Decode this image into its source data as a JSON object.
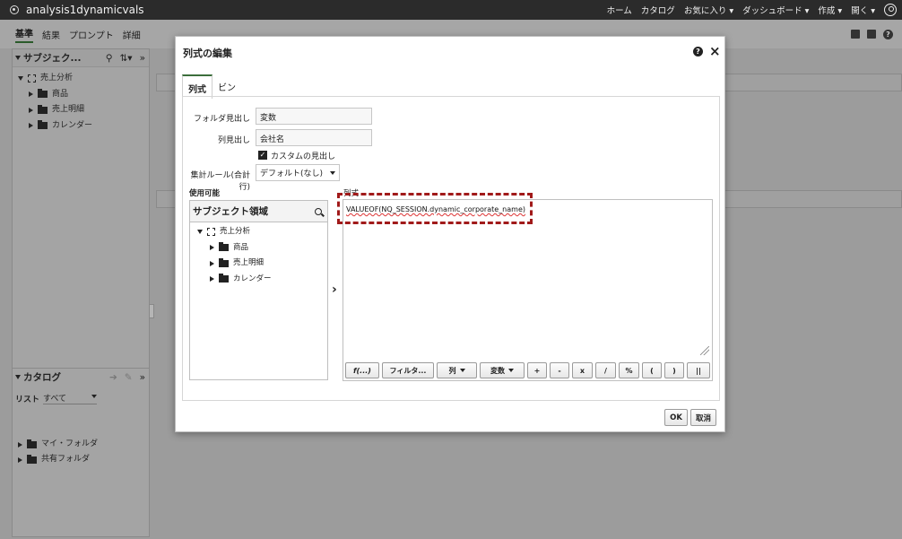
{
  "header": {
    "app_title": "analysis1dynamicvals",
    "nav_items": [
      "ホーム",
      "カタログ",
      "お気に入り ▾",
      "ダッシュボード ▾",
      "作成 ▾",
      "開く ▾"
    ]
  },
  "editor_tabs": [
    "基準",
    "結果",
    "プロンプト",
    "詳細"
  ],
  "left_panel": {
    "title": "サブジェク...",
    "tree": {
      "root": "売上分析",
      "children": [
        "商品",
        "売上明細",
        "カレンダー"
      ]
    },
    "catalog_title": "カタログ",
    "catalog_list_label": "リスト",
    "catalog_list_value": "すべて",
    "catalog_tree": [
      "マイ・フォルダ",
      "共有フォルダ"
    ]
  },
  "dialog": {
    "title": "列式の編集",
    "tabs": [
      "列式",
      "ビン"
    ],
    "folder_heading_label": "フォルダ見出し",
    "folder_heading_value": "変数",
    "column_heading_label": "列見出し",
    "column_heading_value": "会社名",
    "custom_heading_checkbox": "カスタムの見出し",
    "aggregation_label": "集計ルール(合計行)",
    "aggregation_value": "デフォルト(なし)",
    "available_label": "使用可能",
    "subject_area_title": "サブジェクト領域",
    "subject_tree": {
      "root": "売上分析",
      "children": [
        "商品",
        "売上明細",
        "カレンダー"
      ]
    },
    "expression_label": "列式",
    "expression_text": "VALUEOF(NQ_SESSION.dynamic_corporate_name)",
    "buttons": {
      "func": "f(...)",
      "filter": "フィルタ...",
      "column": "列",
      "variable": "変数",
      "plus": "+",
      "minus": "-",
      "times": "x",
      "divide": "/",
      "percent": "%",
      "lparen": "(",
      "rparen": ")",
      "concat": "||"
    },
    "ok": "OK",
    "cancel": "取消"
  },
  "colors": {
    "highlight": "#a11a1a",
    "header_bg": "#2b2b2b",
    "active_tab_accent": "#3b6e3b"
  }
}
